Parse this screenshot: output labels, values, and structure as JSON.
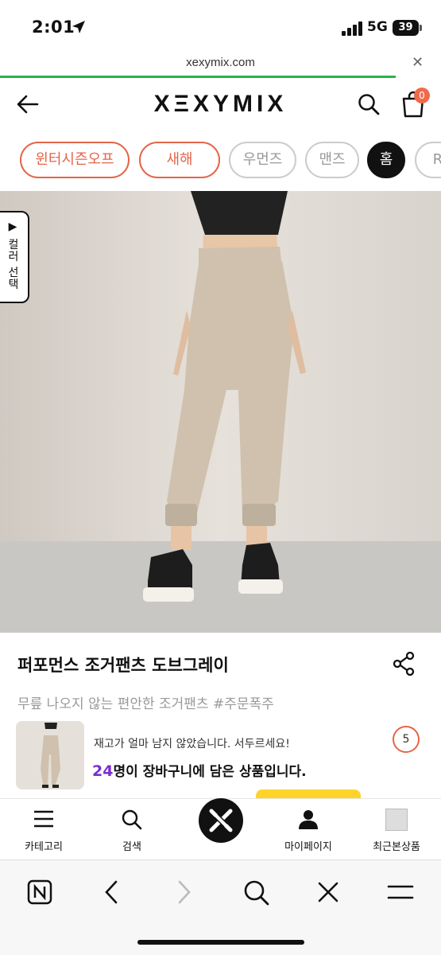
{
  "status_bar": {
    "time": "2:01",
    "network": "5G",
    "battery": "39"
  },
  "browser": {
    "url": "xexymix.com"
  },
  "header": {
    "logo": "XΞXYMIX",
    "cart_count": "0"
  },
  "categories": [
    {
      "label": "윈터시즌오프",
      "style": "highlight"
    },
    {
      "label": "새해",
      "style": "highlight"
    },
    {
      "label": "우먼즈",
      "style": "normal"
    },
    {
      "label": "맨즈",
      "style": "normal"
    },
    {
      "label": "홈",
      "style": "active"
    },
    {
      "label": "RX",
      "style": "normal"
    }
  ],
  "color_select": {
    "label": "▶ 컬러 선택"
  },
  "product": {
    "title": "퍼포먼스 조거팬츠 도브그레이",
    "subtitle": "무릎 나오지 않는 편안한 조거팬츠 #주문폭주"
  },
  "stock_notice": {
    "line1": "재고가 얼마 남지 않았습니다. 서두르세요!",
    "count": "24",
    "line2_suffix": "명이 장바구니에 담은 상품입니다.",
    "badge": "5"
  },
  "bottom_nav": {
    "category": "카테고리",
    "search": "검색",
    "mypage": "마이페이지",
    "recent": "최근본상품"
  },
  "colors": {
    "accent": "#e46548",
    "progress": "#2cb24a",
    "count_purple": "#7a2ed1",
    "cart_badge": "#ee6a4b"
  },
  "icons": [
    "back-arrow-icon",
    "search-icon",
    "cart-icon",
    "share-icon",
    "menu-icon",
    "person-icon",
    "brand-x-icon",
    "tabs-icon",
    "close-icon"
  ]
}
